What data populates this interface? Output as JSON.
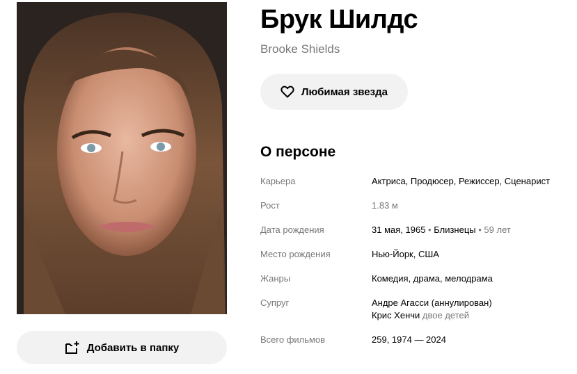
{
  "person": {
    "name_ru": "Брук Шилдс",
    "name_en": "Brooke Shields"
  },
  "actions": {
    "favorite_label": "Любимая звезда",
    "add_folder_label": "Добавить в папку"
  },
  "about": {
    "title": "О персоне",
    "career": {
      "label": "Карьера",
      "value": "Актриса, Продюсер, Режиссер, Сценарист"
    },
    "height": {
      "label": "Рост",
      "value": "1.83 м"
    },
    "birth_date": {
      "label": "Дата рождения",
      "date": "31 мая, 1965",
      "sign": "Близнецы",
      "age": "59 лет"
    },
    "birth_place": {
      "label": "Место рождения",
      "value": "Нью-Йорк, США"
    },
    "genres": {
      "label": "Жанры",
      "value": "Комедия, драма, мелодрама"
    },
    "spouse": {
      "label": "Супруг",
      "spouse1": "Андре Агасси (аннулирован)",
      "spouse2": "Крис Хенчи",
      "spouse2_note": "двое детей"
    },
    "films": {
      "label": "Всего фильмов",
      "value": "259, 1974 — 2024"
    }
  },
  "icons": {
    "favorite": "heart-icon",
    "add_folder": "folder-add-icon"
  },
  "colors": {
    "button_bg": "#f2f2f2",
    "label": "#777777",
    "text": "#000000"
  }
}
